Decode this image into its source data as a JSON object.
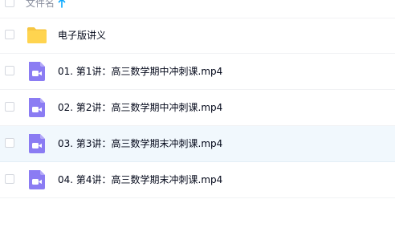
{
  "header": {
    "name_label": "文件名",
    "sort_icon": "arrow-up-icon"
  },
  "colors": {
    "folder": "#ffd44f",
    "video": "#8b7cf3",
    "selected_row_bg": "#f1f8fd",
    "sort_accent": "#06a7ff"
  },
  "files": [
    {
      "name": "电子版讲义",
      "type": "folder",
      "icon": "folder-icon"
    },
    {
      "name": "01. 第1讲：高三数学期中冲刺课.mp4",
      "type": "video",
      "icon": "video-file-icon"
    },
    {
      "name": "02. 第2讲：高三数学期中冲刺课.mp4",
      "type": "video",
      "icon": "video-file-icon"
    },
    {
      "name": "03. 第3讲：高三数学期末冲刺课.mp4",
      "type": "video",
      "icon": "video-file-icon",
      "hovered": true
    },
    {
      "name": "04. 第4讲：高三数学期末冲刺课.mp4",
      "type": "video",
      "icon": "video-file-icon"
    }
  ]
}
